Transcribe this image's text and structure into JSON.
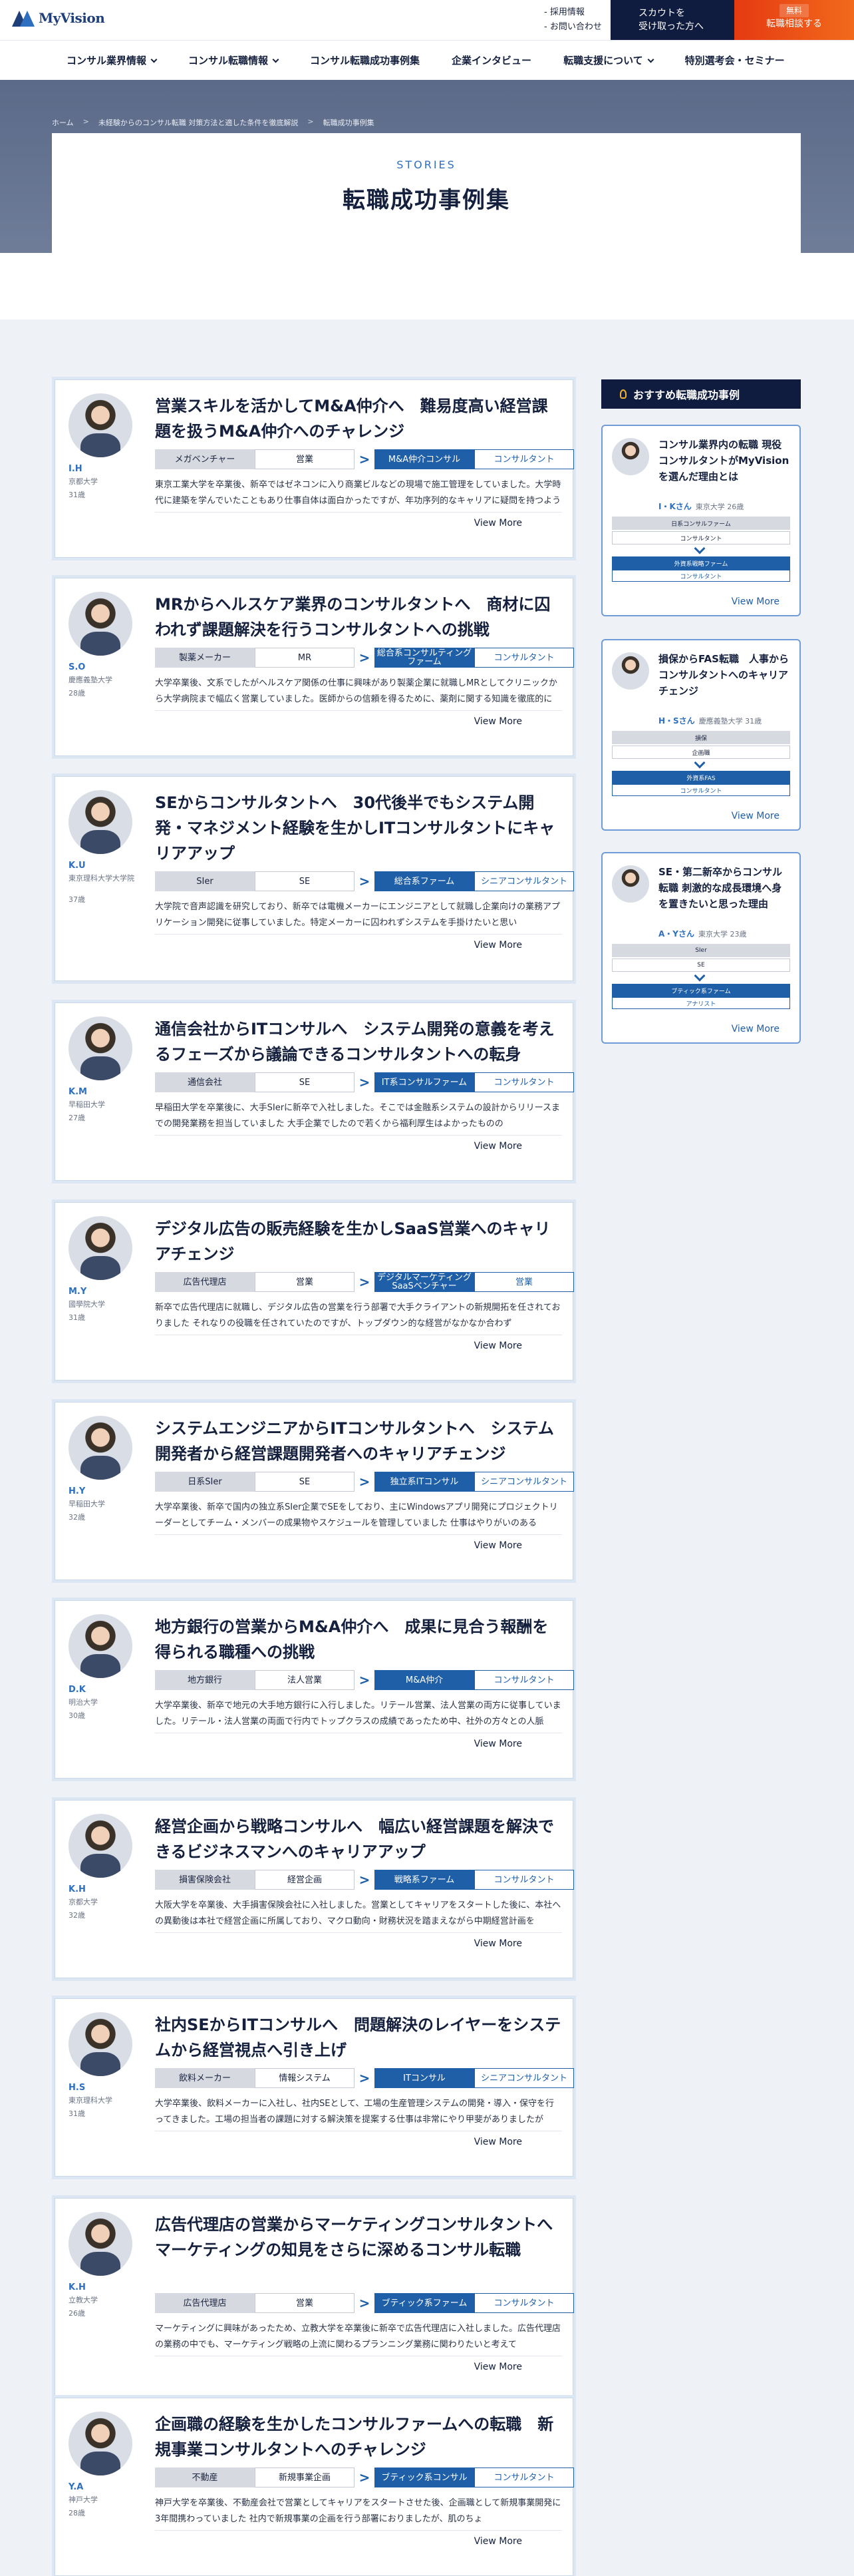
{
  "header": {
    "logo": "MyVision",
    "links": [
      "採用情報",
      "お問い合わせ"
    ],
    "scout_button": [
      "スカウトを",
      "受け取った方へ"
    ],
    "free_badge": "無料",
    "consult_button": "転職相談する",
    "nav": [
      {
        "label": "コンサル業界情報",
        "dropdown": true
      },
      {
        "label": "コンサル転職情報",
        "dropdown": true
      },
      {
        "label": "コンサル転職成功事例集",
        "dropdown": false
      },
      {
        "label": "企業インタビュー",
        "dropdown": false
      },
      {
        "label": "転職支援について",
        "dropdown": true
      },
      {
        "label": "特別選考会・セミナー",
        "dropdown": false
      }
    ]
  },
  "breadcrumb": [
    "ホーム",
    "未経験からのコンサル転職 対策方法と適した条件を徹底解説",
    "転職成功事例集"
  ],
  "hero": {
    "kicker": "STORIES",
    "title": "転職成功事例集"
  },
  "cards": [
    {
      "title": "営業スキルを活かしてM&A仲介へ　難易度高い経営課題を扱うM&A仲介へのチャレンジ",
      "name": "I.H",
      "school": "京都大学",
      "age": "31歳",
      "from": [
        "メガベンチャー",
        "営業"
      ],
      "to": [
        "M&A仲介コンサル",
        "コンサルタント"
      ],
      "excerpt": "東京工業大学を卒業後、新卒ではゼネコンに入り商業ビルなどの現場で施工管理をしていました。大学時代に建築を学んでいたこともあり仕事自体は面白かったですが、年功序列的なキャリアに疑問を持つように",
      "more": "View More"
    },
    {
      "title": "MRからヘルスケア業界のコンサルタントへ　商材に囚われず課題解決を行うコンサルタントへの挑戦",
      "name": "S.O",
      "school": "慶應義塾大学",
      "age": "28歳",
      "from": [
        "製薬メーカー",
        "MR"
      ],
      "to": [
        "総合系コンサルティングファーム",
        "コンサルタント"
      ],
      "excerpt": "大学卒業後、文系でしたがヘルスケア関係の仕事に興味があり製薬企業に就職しMRとしてクリニックから大学病院まで幅広く営業していました。医師からの信頼を得るために、薬剤に関する知識を徹底的に",
      "more": "View More"
    },
    {
      "title": "SEからコンサルタントへ　30代後半でもシステム開発・マネジメント経験を生かしITコンサルタントにキャリアアップ",
      "name": "K.U",
      "school": "東京理科大学大学院",
      "age": "37歳",
      "from": [
        "SIer",
        "SE"
      ],
      "to": [
        "総合系ファーム",
        "シニアコンサルタント"
      ],
      "excerpt": "大学院で音声認識を研究しており、新卒では電機メーカーにエンジニアとして就職し企業向けの業務アプリケーション開発に従事していました。特定メーカーに囚われずシステムを手掛けたいと思い",
      "more": "View More"
    },
    {
      "title": "通信会社からITコンサルへ　システム開発の意義を考えるフェーズから議論できるコンサルタントへの転身",
      "name": "K.M",
      "school": "早稲田大学",
      "age": "27歳",
      "from": [
        "通信会社",
        "SE"
      ],
      "to": [
        "IT系コンサルファーム",
        "コンサルタント"
      ],
      "excerpt": "早稲田大学を卒業後に、大手SIerに新卒で入社しました。そこでは金融系システムの設計からリリースまでの開発業務を担当していました 大手企業でしたので若くから福利厚生はよかったものの",
      "more": "View More"
    },
    {
      "title": "デジタル広告の販売経験を生かしSaaS営業へのキャリアチェンジ",
      "name": "M.Y",
      "school": "國學院大学",
      "age": "31歳",
      "from": [
        "広告代理店",
        "営業"
      ],
      "to": [
        "デジタルマーケティングSaaSベンチャー",
        "営業"
      ],
      "excerpt": "新卒で広告代理店に就職し、デジタル広告の営業を行う部署で大手クライアントの新規開拓を任されておりました それなりの役職を任されていたのですが、トップダウン的な経営がなかなか合わず",
      "more": "View More"
    },
    {
      "title": "システムエンジニアからITコンサルタントへ　システム開発者から経営課題開発者へのキャリアチェンジ",
      "name": "H.Y",
      "school": "早稲田大学",
      "age": "32歳",
      "from": [
        "日系SIer",
        "SE"
      ],
      "to": [
        "独立系ITコンサル",
        "シニアコンサルタント"
      ],
      "excerpt": "大学卒業後、新卒で国内の独立系SIer企業でSEをしており、主にWindowsアプリ開発にプロジェクトリーダーとしてチーム・メンバーの成果物やスケジュールを管理していました 仕事はやりがいのある",
      "more": "View More"
    },
    {
      "title": "地方銀行の営業からM&A仲介へ　成果に見合う報酬を得られる職種への挑戦",
      "name": "D.K",
      "school": "明治大学",
      "age": "30歳",
      "from": [
        "地方銀行",
        "法人営業"
      ],
      "to": [
        "M&A仲介",
        "コンサルタント"
      ],
      "excerpt": "大学卒業後、新卒で地元の大手地方銀行に入行しました。リテール営業、法人営業の両方に従事していました。リテール・法人営業の両面で行内でトップクラスの成績であったため中、社外の方々との人脈",
      "more": "View More"
    },
    {
      "title": "経営企画から戦略コンサルへ　幅広い経営課題を解決できるビジネスマンへのキャリアアップ",
      "name": "K.H",
      "school": "京都大学",
      "age": "32歳",
      "from": [
        "損害保険会社",
        "経営企画"
      ],
      "to": [
        "戦略系ファーム",
        "コンサルタント"
      ],
      "excerpt": "大阪大学を卒業後、大手損害保険会社に入社しました。営業としてキャリアをスタートした後に、本社への異動後は本社で経営企画に所属しており、マクロ動向・財務状況を踏まえながら中期経営計画を",
      "more": "View More"
    },
    {
      "title": "社内SEからITコンサルへ　問題解決のレイヤーをシステムから経営視点へ引き上げ",
      "name": "H.S",
      "school": "東京理科大学",
      "age": "31歳",
      "from": [
        "飲料メーカー",
        "情報システム"
      ],
      "to": [
        "ITコンサル",
        "シニアコンサルタント"
      ],
      "excerpt": "大学卒業後、飲料メーカーに入社し、社内SEとして、工場の生産管理システムの開発・導入・保守を行ってきました。工場の担当者の課題に対する解決策を提案する仕事は非常にやり甲斐がありましたが",
      "more": "View More"
    },
    {
      "title": "広告代理店の営業からマーケティングコンサルタントへ　マーケティングの知見をさらに深めるコンサル転職",
      "name": "K.H",
      "school": "立教大学",
      "age": "26歳",
      "from": [
        "広告代理店",
        "営業"
      ],
      "to": [
        "ブティック系ファーム",
        "コンサルタント"
      ],
      "excerpt": "マーケティングに興味があったため、立教大学を卒業後に新卒で広告代理店に入社しました。広告代理店の業務の中でも、マーケティング戦略の上流に関わるプランニング業務に関わりたいと考えて",
      "more": "View More"
    },
    {
      "title": "企画職の経験を生かしたコンサルファームへの転職　新規事業コンサルタントへのチャレンジ",
      "name": "Y.A",
      "school": "神戸大学",
      "age": "28歳",
      "from": [
        "不動産",
        "新規事業企画"
      ],
      "to": [
        "ブティック系コンサル",
        "コンサルタント"
      ],
      "excerpt": "神戸大学を卒業後、不動産会社で営業としてキャリアをスタートさせた後、企画職として新規事業開発に3年間携わっていました 社内で新規事業の企画を行う部署におりましたが、肌のちょ",
      "more": "View More"
    }
  ],
  "sidebar": {
    "heading": "おすすめ転職成功事例",
    "items": [
      {
        "title": "コンサル業界内の転職 現役コンサルタントがMyVisionを選んだ理由とは",
        "name": "I・Kさん",
        "meta": "東京大学 26歳",
        "from": [
          "日系コンサルファーム",
          "コンサルタント"
        ],
        "to": [
          "外資系戦略ファーム",
          "コンサルタント"
        ],
        "more": "View More"
      },
      {
        "title": "損保からFAS転職　人事からコンサルタントへのキャリアチェンジ",
        "name": "H・Sさん",
        "meta": "慶應義塾大学 31歳",
        "from": [
          "損保",
          "企画職"
        ],
        "to": [
          "外資系FAS",
          "コンサルタント"
        ],
        "more": "View More"
      },
      {
        "title": "SE・第二新卒からコンサル転職 刺激的な成長環境へ身を置きたいと思った理由",
        "name": "A・Yさん",
        "meta": "東京大学 23歳",
        "from": [
          "SIer",
          "SE"
        ],
        "to": [
          "ブティック系ファーム",
          "アナリスト"
        ],
        "more": "View More"
      }
    ]
  }
}
